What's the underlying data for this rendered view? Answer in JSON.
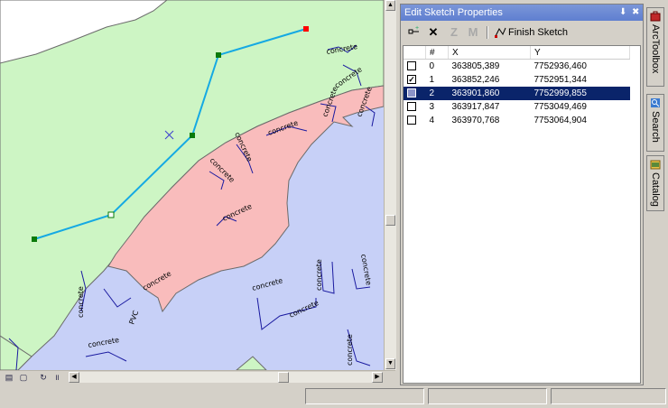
{
  "panel": {
    "title": "Edit Sketch Properties",
    "pin_glyph": "⬇",
    "close_glyph": "✖",
    "toolbar": {
      "z_label": "Z",
      "m_label": "M",
      "finish_label": "Finish Sketch"
    },
    "columns": [
      "#",
      "X",
      "Y"
    ],
    "rows": [
      {
        "num": "0",
        "x": "363805,389",
        "y": "7752936,460",
        "checked": false
      },
      {
        "num": "1",
        "x": "363852,246",
        "y": "7752951,344",
        "checked": true
      },
      {
        "num": "2",
        "x": "363901,860",
        "y": "7752999,855",
        "checked": false,
        "selected": true
      },
      {
        "num": "3",
        "x": "363917,847",
        "y": "7753049,469",
        "checked": false
      },
      {
        "num": "4",
        "x": "363970,768",
        "y": "7753064,904",
        "checked": false
      }
    ]
  },
  "side_tabs": [
    {
      "label": "ArcToolbox",
      "icon": "toolbox-icon"
    },
    {
      "label": "Search",
      "icon": "search-icon"
    },
    {
      "label": "Catalog",
      "icon": "catalog-icon"
    }
  ],
  "map": {
    "labels": {
      "concrete": "concrete",
      "pvc": "PVC"
    }
  },
  "colors": {
    "land": "#cdf5c4",
    "water": "#c7d0f7",
    "zone": "#f9bcbc",
    "sketch_line": "#15a9e3",
    "vertex": "#0a7a0a",
    "last_vertex": "#ff0000",
    "selection": "#0a246a"
  }
}
